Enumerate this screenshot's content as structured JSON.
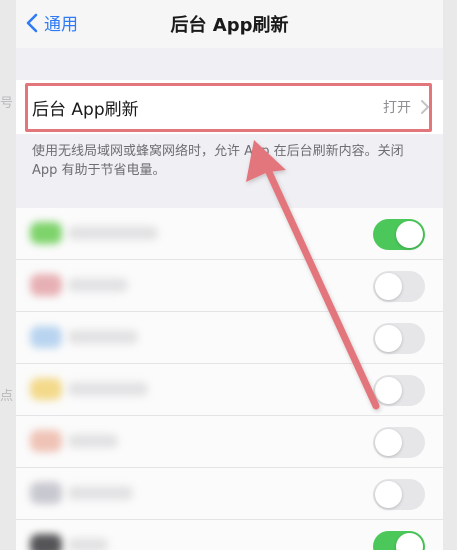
{
  "nav": {
    "back_label": "通用",
    "title": "后台 App刷新"
  },
  "setting": {
    "label": "后台 App刷新",
    "value": "打开"
  },
  "footnote": "使用无线局域网或蜂窝网络时，允许 App 在后台刷新内容。关闭 App 有助于节省电量。",
  "side_glyphs": [
    "号",
    "点"
  ],
  "apps": [
    {
      "on": true,
      "icon_color": "#7ed36b"
    },
    {
      "on": false,
      "icon_color": "#e7b0b4"
    },
    {
      "on": false,
      "icon_color": "#b9d4f0"
    },
    {
      "on": false,
      "icon_color": "#f3d98a"
    },
    {
      "on": false,
      "icon_color": "#efc3b6"
    },
    {
      "on": false,
      "icon_color": "#c8c8d0"
    },
    {
      "on": true,
      "icon_color": "#555558"
    }
  ],
  "colors": {
    "accent": "#2f7bf5",
    "toggle_on": "#4cc85a",
    "annotation": "#e2767b"
  }
}
